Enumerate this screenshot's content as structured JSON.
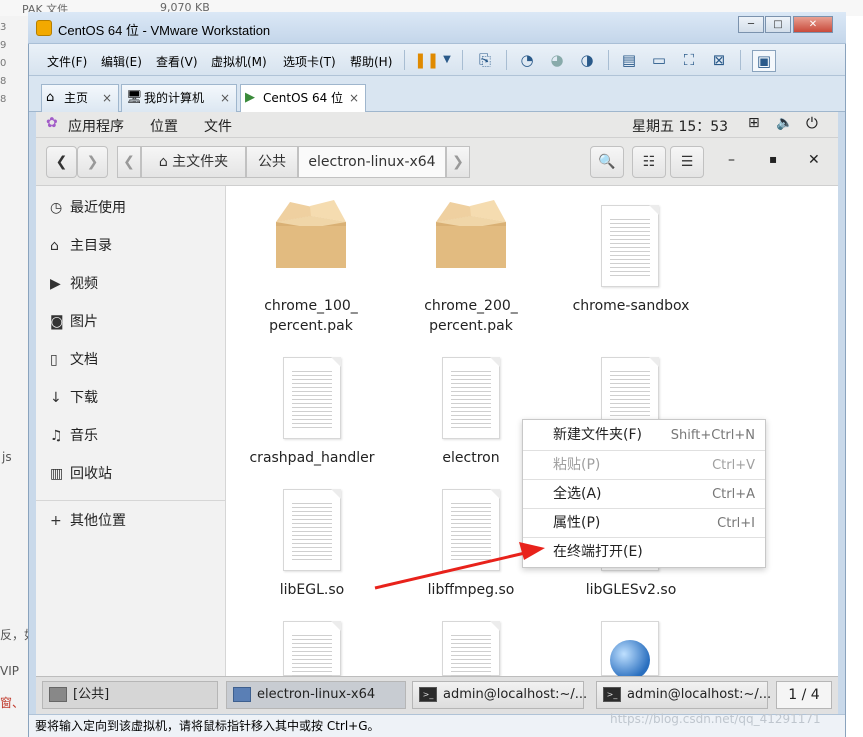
{
  "host": {
    "toprow_label": "PAK 文件",
    "toprow_size": "9,070 KB",
    "row_nums": [
      "3",
      "9",
      "0",
      "8",
      "8"
    ],
    "left_frag1": "js",
    "left_frag2": "反，如",
    "left_frag3": "VIP",
    "left_frag4": "窗、"
  },
  "window": {
    "title": "CentOS 64 位 - VMware Workstation",
    "btn_min": "─",
    "btn_max": "□",
    "btn_close": "✕"
  },
  "menubar": [
    "文件(F)",
    "编辑(E)",
    "查看(V)",
    "虚拟机(M)",
    "选项卡(T)",
    "帮助(H)"
  ],
  "tabs": [
    {
      "icon": "⌂",
      "label": "主页"
    },
    {
      "icon": "🖥",
      "label": "我的计算机"
    },
    {
      "icon": "▶",
      "label": "CentOS 64 位"
    }
  ],
  "tab_close": "×",
  "gnome_top": {
    "apps": "应用程序",
    "places": "位置",
    "files": "文件",
    "clock": "星期五 15：53"
  },
  "breadcrumb": {
    "home": "主文件夹",
    "public": "公共",
    "current": "electron-linux-x64"
  },
  "sidebar": [
    {
      "icon": "◷",
      "label": "最近使用"
    },
    {
      "icon": "⌂",
      "label": "主目录"
    },
    {
      "icon": "▶",
      "label": "视频"
    },
    {
      "icon": "◙",
      "label": "图片"
    },
    {
      "icon": "▯",
      "label": "文档"
    },
    {
      "icon": "↓",
      "label": "下载"
    },
    {
      "icon": "♫",
      "label": "音乐"
    },
    {
      "icon": "▥",
      "label": "回收站"
    },
    {
      "icon": "+",
      "label": "其他位置"
    }
  ],
  "files": [
    {
      "name_line1": "chrome_100_",
      "name_line2": "percent.pak",
      "type": "package"
    },
    {
      "name_line1": "chrome_200_",
      "name_line2": "percent.pak",
      "type": "package"
    },
    {
      "name_line1": "chrome-sandbox",
      "name_line2": "",
      "type": "doc"
    },
    {
      "name_line1": "crashpad_handler",
      "name_line2": "",
      "type": "doc"
    },
    {
      "name_line1": "electron",
      "name_line2": "",
      "type": "doc"
    },
    {
      "name_line1": "libEGL.so",
      "name_line2": "",
      "type": "doc"
    },
    {
      "name_line1": "libffmpeg.so",
      "name_line2": "",
      "type": "doc"
    },
    {
      "name_line1": "libGLESv2.so",
      "name_line2": "",
      "type": "doc"
    }
  ],
  "context_menu": [
    {
      "label": "新建文件夹(F)",
      "shortcut": "Shift+Ctrl+N",
      "enabled": true
    },
    {
      "label": "粘贴(P)",
      "shortcut": "Ctrl+V",
      "enabled": false
    },
    {
      "label": "全选(A)",
      "shortcut": "Ctrl+A",
      "enabled": true
    },
    {
      "label": "属性(P)",
      "shortcut": "Ctrl+I",
      "enabled": true
    },
    {
      "label": "在终端打开(E)",
      "shortcut": "",
      "enabled": true
    }
  ],
  "taskbar": {
    "item1": "[公共]",
    "item2": "electron-linux-x64",
    "item3": "admin@localhost:~/...",
    "item4": "admin@localhost:~/...",
    "pager": "1 / 4"
  },
  "statusbar": "要将输入定向到该虚拟机，请将鼠标指针移入其中或按 Ctrl+G。",
  "watermark": "https://blog.csdn.net/qq_41291171",
  "colors": {
    "arrow": "#e8221b",
    "accent": "#4a90d9"
  }
}
